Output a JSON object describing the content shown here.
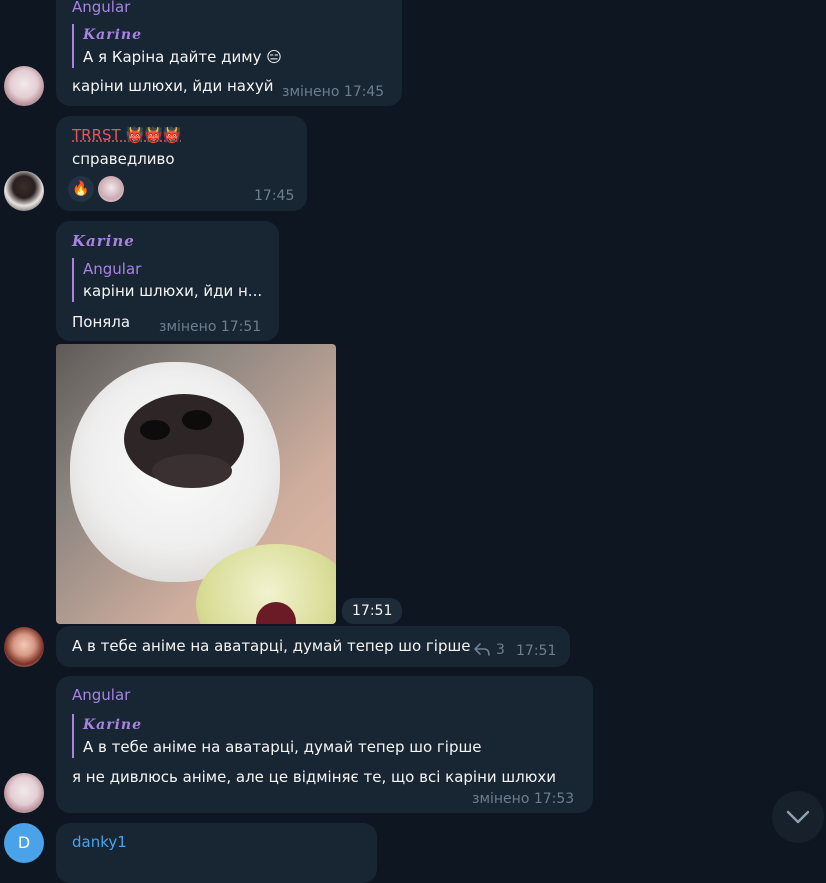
{
  "messages": {
    "m1": {
      "sender": "Angular",
      "quote_name": "Karine",
      "quote_text": "А я Каріна дайте диму 😑",
      "text": "каріни шлюхи, йди нахуй",
      "time": "змінено 17:45"
    },
    "m2": {
      "sender": "TRRST 👹👹👹",
      "text": "справедливо",
      "time": "17:45",
      "reactions": [
        "🔥"
      ]
    },
    "m3": {
      "sender": "Karine",
      "quote_name": "Angular",
      "quote_text": "каріни шлюхи, йди н...",
      "text": "Поняла",
      "time": "змінено 17:51"
    },
    "m4": {
      "time": "17:51"
    },
    "m5": {
      "text": "А в тебе аніме на аватарці, думай тепер шо гірше",
      "replies": "3",
      "time": "17:51"
    },
    "m6": {
      "sender": "Angular",
      "quote_name": "Karine",
      "quote_text": "А в тебе аніме на аватарці, думай тепер шо гірше",
      "text": "я не дивлюсь аніме, але це відміняє те, що всі каріни шлюхи",
      "time": "змінено 17:53"
    },
    "m7": {
      "avatar_letter": "D",
      "sender": "danky1"
    }
  },
  "colors": {
    "background": "#0e1621",
    "bubble": "#182533",
    "accent_name": "#a983e4",
    "trrst_name": "#e5575f",
    "danky_name": "#4aa3e8"
  },
  "icons": {
    "reply": "reply-arrow-icon",
    "scroll": "chevron-down-icon"
  }
}
